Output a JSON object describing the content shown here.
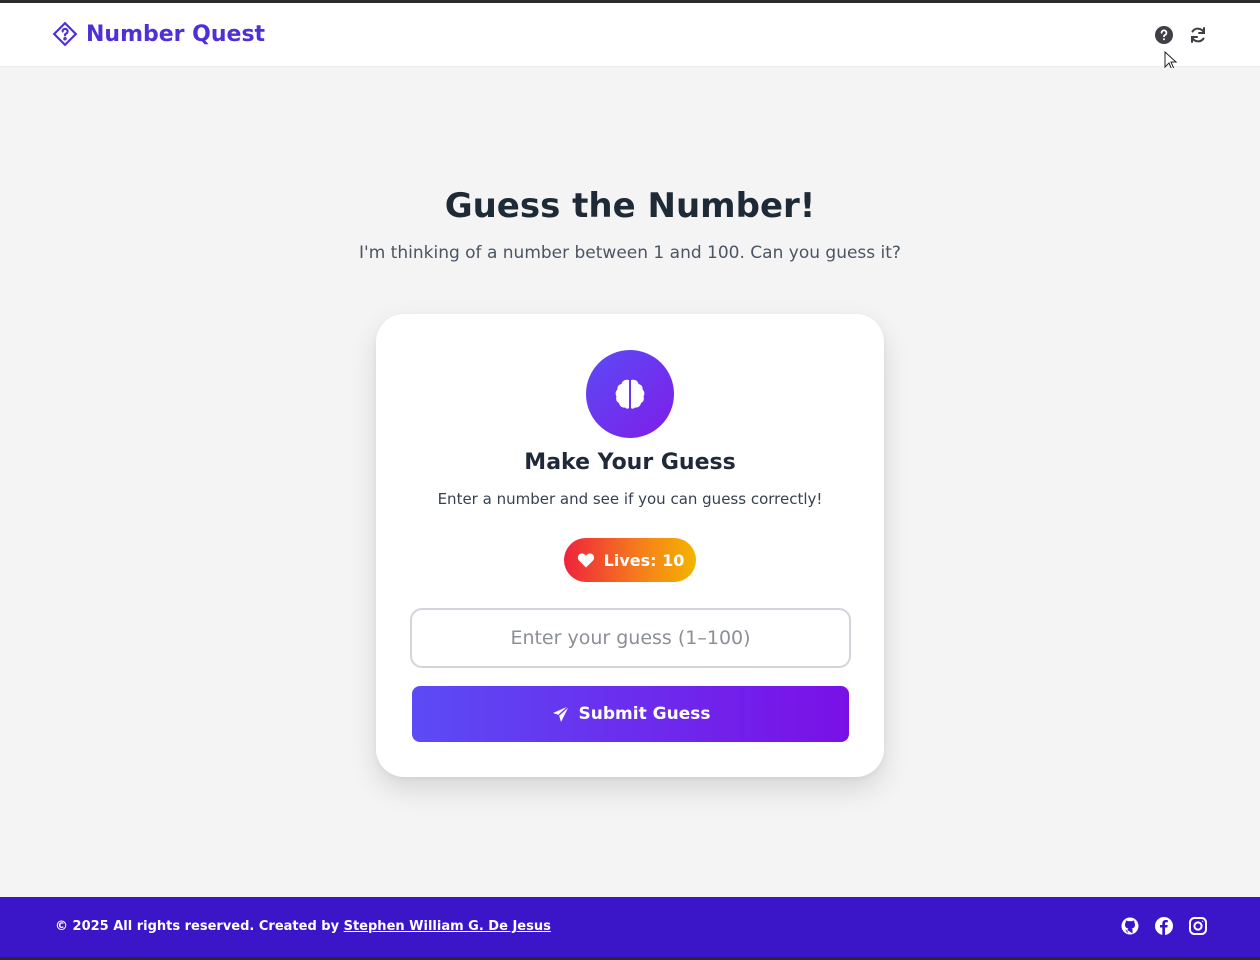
{
  "header": {
    "brand": "Number Quest",
    "icons": [
      "help-icon",
      "refresh-icon"
    ]
  },
  "hero": {
    "title": "Guess the Number!",
    "subtitle": "I'm thinking of a number between 1 and 100. Can you guess it?"
  },
  "card": {
    "icon": "brain-icon",
    "title": "Make Your Guess",
    "subtitle": "Enter a number and see if you can guess correctly!",
    "lives_label": "Lives: 10",
    "input_placeholder": "Enter your guess (1–100)",
    "input_value": "",
    "submit_label": "Submit Guess"
  },
  "footer": {
    "copyright": "© 2025 All rights reserved. Created by",
    "author": "Stephen William G. De Jesus",
    "social": [
      "github-icon",
      "facebook-icon",
      "instagram-icon"
    ]
  },
  "colors": {
    "brand": "#4f2fd8",
    "accent_start": "#5b4bf5",
    "accent_end": "#7a10e6",
    "footer_bg": "#3a16c8",
    "lives_start": "#ef233c",
    "lives_end": "#f5b400"
  }
}
